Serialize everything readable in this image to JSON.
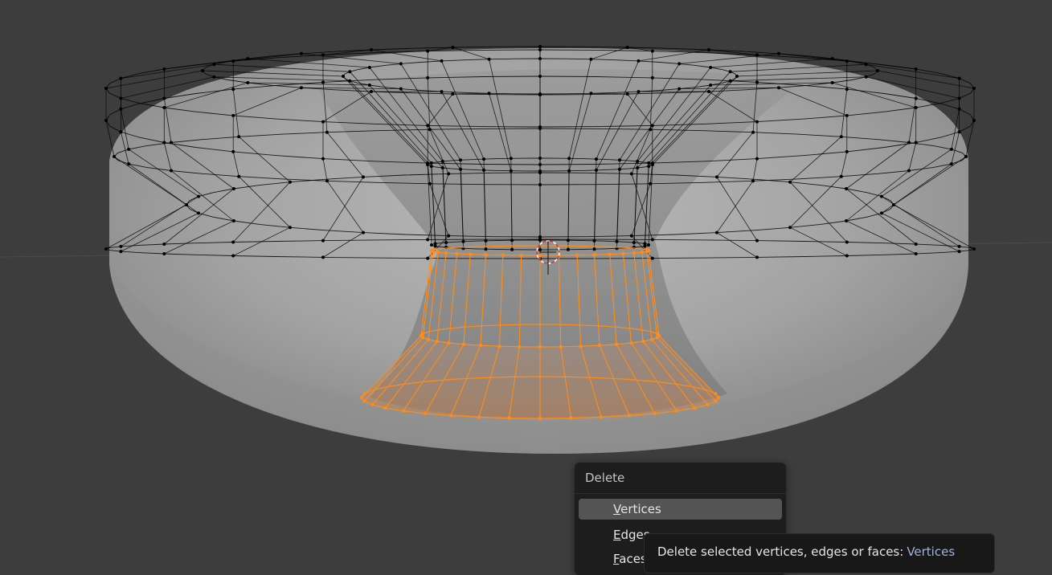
{
  "viewport": {
    "colors": {
      "background": "#3d3d3d",
      "mesh_surface": "#a8a8a8",
      "wire_unselected": "#000000",
      "wire_selected": "#ff8c1a",
      "cursor_red": "#d43b3b"
    },
    "icons": [
      "3d-cursor-icon"
    ]
  },
  "delete_menu": {
    "title": "Delete",
    "items": [
      {
        "hotkey_letter": "V",
        "rest": "ertices",
        "active": true
      },
      {
        "hotkey_letter": "E",
        "rest": "dges",
        "active": false
      },
      {
        "hotkey_letter": "F",
        "rest": "aces",
        "active": false
      }
    ]
  },
  "tooltip": {
    "text": "Delete selected vertices, edges or faces:",
    "value": "Vertices"
  }
}
